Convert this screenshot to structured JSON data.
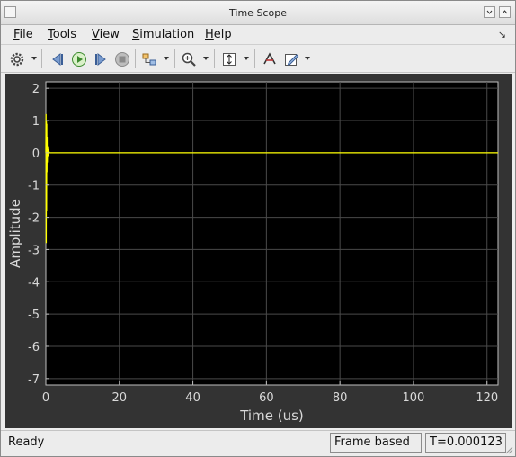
{
  "window": {
    "title": "Time Scope"
  },
  "menu": [
    {
      "key": "F",
      "rest": "ile"
    },
    {
      "key": "T",
      "rest": "ools"
    },
    {
      "key": "V",
      "rest": "iew"
    },
    {
      "key": "S",
      "rest": "imulation"
    },
    {
      "key": "H",
      "rest": "elp"
    }
  ],
  "toolbar": {
    "icons": [
      "settings-icon",
      "step-back-icon",
      "run-icon",
      "step-forward-icon",
      "stop-icon",
      "signal-highlight-icon",
      "zoom-in-icon",
      "autoscale-icon",
      "measurements-icon",
      "style-edit-icon"
    ]
  },
  "chart_data": {
    "type": "line",
    "xlabel": "Time (us)",
    "ylabel": "Amplitude",
    "xlim": [
      0,
      123
    ],
    "ylim": [
      -7.2,
      2.2
    ],
    "xticks": [
      0,
      20,
      40,
      60,
      80,
      100,
      120
    ],
    "yticks": [
      2,
      1,
      0,
      -1,
      -2,
      -3,
      -4,
      -5,
      -6,
      -7
    ],
    "grid": true,
    "background": "#000000",
    "series": [
      {
        "color": "#ffff00",
        "x": [
          0,
          0.05,
          0.1,
          0.15,
          0.2,
          0.25,
          0.3,
          0.35,
          0.4,
          0.5,
          0.6,
          0.8,
          1.0,
          1.2,
          2,
          123
        ],
        "y": [
          0,
          1.2,
          -2.8,
          1.0,
          -1.8,
          0.9,
          -0.6,
          0.5,
          -0.3,
          0.2,
          -0.1,
          0.05,
          0.0,
          0.0,
          0.0,
          0.0
        ]
      }
    ]
  },
  "status": {
    "left": "Ready",
    "mode": "Frame based",
    "time": "T=0.000123"
  }
}
